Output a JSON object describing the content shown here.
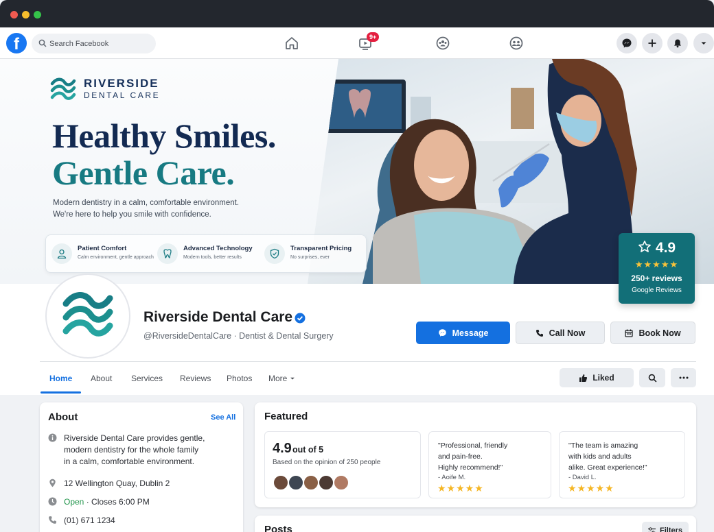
{
  "topnav": {
    "search_placeholder": "Search Facebook",
    "video_badge": "9+"
  },
  "cover": {
    "brand_name": "RIVERSIDE",
    "brand_sub": "DENTAL CARE",
    "headline_1": "Healthy Smiles.",
    "headline_2": "Gentle Care.",
    "tagline_1": "Modern dentistry in a calm, comfortable environment.",
    "tagline_2": "We're here to help you smile with confidence.",
    "features": [
      {
        "title": "Patient Comfort",
        "subtitle": "Calm environment, gentle approach",
        "icon": "person-icon"
      },
      {
        "title": "Advanced Technology",
        "subtitle": "Modern tools, better results",
        "icon": "tooth-icon"
      },
      {
        "title": "Transparent Pricing",
        "subtitle": "No surprises, ever",
        "icon": "shield-check-icon"
      }
    ],
    "rating": {
      "score": "4.9",
      "stars": "★★★★★",
      "reviews": "250+ reviews",
      "source": "Google Reviews"
    }
  },
  "profile": {
    "name": "Riverside Dental Care",
    "handle": "@RiversideDentalCare · Dentist & Dental Surgery",
    "buttons": {
      "message": "Message",
      "call": "Call Now",
      "book": "Book Now"
    }
  },
  "tabs": [
    "Home",
    "About",
    "Services",
    "Reviews",
    "Photos",
    "More"
  ],
  "tab_actions": {
    "liked": "Liked"
  },
  "about": {
    "title": "About",
    "see_all": "See All",
    "description_lines": [
      "Riverside Dental Care provides gentle,",
      "modern dentistry for the whole family",
      "in a calm, comfortable environment."
    ],
    "address": "12 Wellington Quay, Dublin 2",
    "open_status": "Open",
    "hours": "· Closes 6:00 PM",
    "phone": "(01) 671 1234"
  },
  "featured": {
    "title": "Featured",
    "score": "4.9",
    "out_of": "out of 5",
    "basis": "Based on the opinion of 250 people",
    "reviews": [
      {
        "lines": [
          "\"Professional, friendly",
          "and pain-free.",
          "Highly recommend!\""
        ],
        "author": "- Aoife M.",
        "stars": "★★★★★"
      },
      {
        "lines": [
          "\"The team is amazing",
          "with kids and adults",
          "alike. Great experience!\""
        ],
        "author": "- David L.",
        "stars": "★★★★★"
      }
    ]
  },
  "posts": {
    "title": "Posts",
    "filters": "Filters"
  },
  "colors": {
    "accent": "#1470e0",
    "brand_navy": "#132a52",
    "brand_teal": "#177a82",
    "rating_card": "#126f78",
    "star": "#f5b624"
  }
}
